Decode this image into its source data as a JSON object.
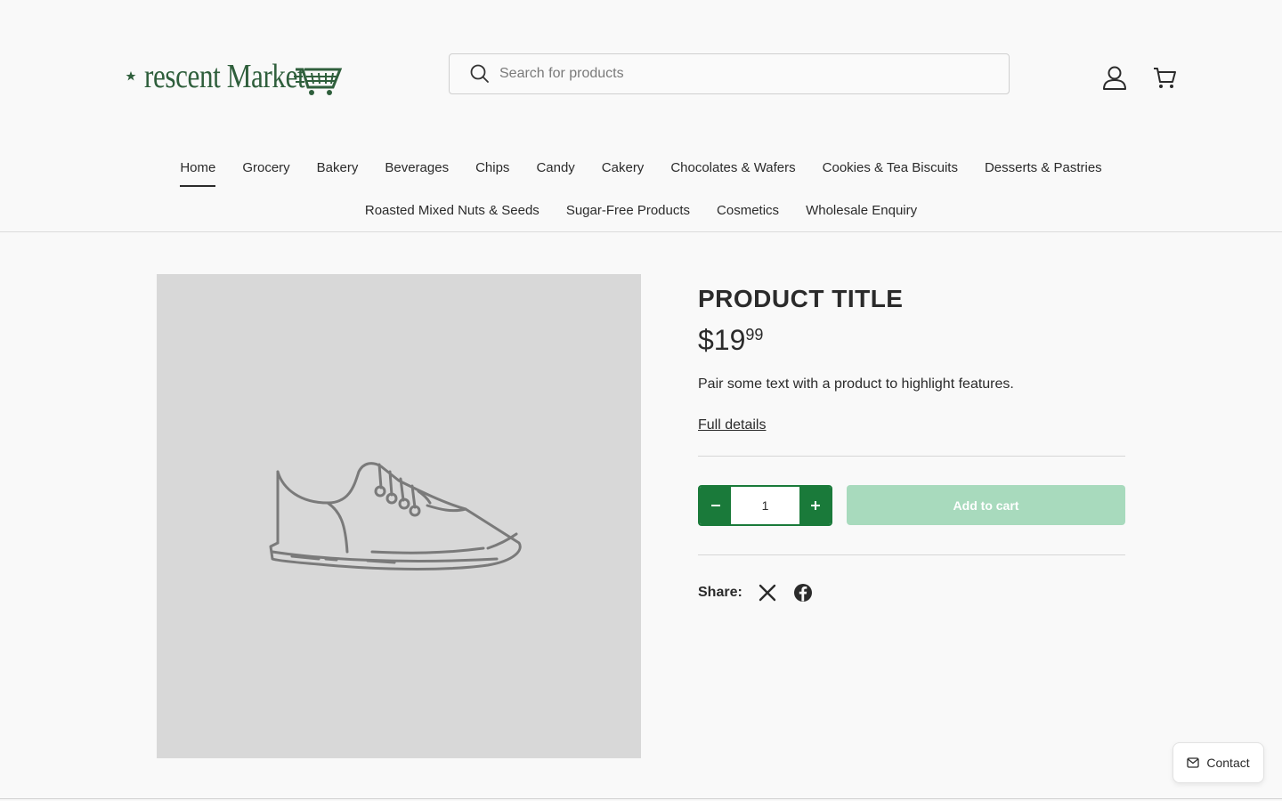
{
  "header": {
    "logo_text": "rescent Market",
    "search_placeholder": "Search for products",
    "account_icon": "user-icon",
    "cart_icon": "cart-icon"
  },
  "nav": {
    "row1": [
      "Home",
      "Grocery",
      "Bakery",
      "Beverages",
      "Chips",
      "Candy",
      "Cakery",
      "Chocolates & Wafers",
      "Cookies & Tea Biscuits",
      "Desserts & Pastries"
    ],
    "row2": [
      "Roasted Mixed Nuts & Seeds",
      "Sugar-Free Products",
      "Cosmetics",
      "Wholesale Enquiry"
    ],
    "active": "Home"
  },
  "product": {
    "title": "PRODUCT TITLE",
    "price_main": "$19",
    "price_cents": "99",
    "description": "Pair some text with a product to highlight features.",
    "details_link": "Full details",
    "quantity": "1",
    "add_to_cart": "Add to cart",
    "image_icon": "shoe-placeholder-icon"
  },
  "share": {
    "label": "Share:",
    "icons": [
      "x-icon",
      "facebook-icon"
    ]
  },
  "contact": {
    "label": "Contact",
    "icon": "mail-icon"
  },
  "colors": {
    "brand_green": "#2f5f3c",
    "button_green": "#1a7a3a",
    "add_cart_disabled": "#a8dabd",
    "image_bg": "#d8d8d8"
  }
}
